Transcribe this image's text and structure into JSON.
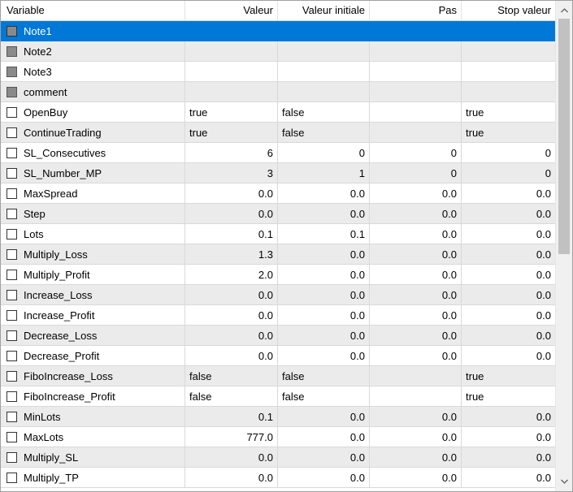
{
  "columns": [
    "Variable",
    "Valeur",
    "Valeur initiale",
    "Pas",
    "Stop valeur"
  ],
  "icons": {
    "scroll_up": "chevron-up-icon",
    "scroll_down": "chevron-down-icon"
  },
  "rows": [
    {
      "name": "Note1",
      "value": "",
      "initial": "",
      "step": "",
      "stop": "",
      "checkbox": "gray",
      "selected": true,
      "align": "r"
    },
    {
      "name": "Note2",
      "value": "",
      "initial": "",
      "step": "",
      "stop": "",
      "checkbox": "gray",
      "align": "r"
    },
    {
      "name": "Note3",
      "value": "",
      "initial": "",
      "step": "",
      "stop": "",
      "checkbox": "gray",
      "align": "r"
    },
    {
      "name": "comment",
      "value": "",
      "initial": "",
      "step": "",
      "stop": "",
      "checkbox": "gray",
      "align": "r"
    },
    {
      "name": "OpenBuy",
      "value": "true",
      "initial": "false",
      "step": "",
      "stop": "true",
      "checkbox": "white",
      "align": "l"
    },
    {
      "name": "ContinueTrading",
      "value": "true",
      "initial": "false",
      "step": "",
      "stop": "true",
      "checkbox": "white",
      "align": "l"
    },
    {
      "name": "SL_Consecutives",
      "value": "6",
      "initial": "0",
      "step": "0",
      "stop": "0",
      "checkbox": "white",
      "align": "r"
    },
    {
      "name": "SL_Number_MP",
      "value": "3",
      "initial": "1",
      "step": "0",
      "stop": "0",
      "checkbox": "white",
      "align": "r"
    },
    {
      "name": "MaxSpread",
      "value": "0.0",
      "initial": "0.0",
      "step": "0.0",
      "stop": "0.0",
      "checkbox": "white",
      "align": "r"
    },
    {
      "name": "Step",
      "value": "0.0",
      "initial": "0.0",
      "step": "0.0",
      "stop": "0.0",
      "checkbox": "white",
      "align": "r"
    },
    {
      "name": "Lots",
      "value": "0.1",
      "initial": "0.1",
      "step": "0.0",
      "stop": "0.0",
      "checkbox": "white",
      "align": "r"
    },
    {
      "name": "Multiply_Loss",
      "value": "1.3",
      "initial": "0.0",
      "step": "0.0",
      "stop": "0.0",
      "checkbox": "white",
      "align": "r"
    },
    {
      "name": "Multiply_Profit",
      "value": "2.0",
      "initial": "0.0",
      "step": "0.0",
      "stop": "0.0",
      "checkbox": "white",
      "align": "r"
    },
    {
      "name": "Increase_Loss",
      "value": "0.0",
      "initial": "0.0",
      "step": "0.0",
      "stop": "0.0",
      "checkbox": "white",
      "align": "r"
    },
    {
      "name": "Increase_Profit",
      "value": "0.0",
      "initial": "0.0",
      "step": "0.0",
      "stop": "0.0",
      "checkbox": "white",
      "align": "r"
    },
    {
      "name": "Decrease_Loss",
      "value": "0.0",
      "initial": "0.0",
      "step": "0.0",
      "stop": "0.0",
      "checkbox": "white",
      "align": "r"
    },
    {
      "name": "Decrease_Profit",
      "value": "0.0",
      "initial": "0.0",
      "step": "0.0",
      "stop": "0.0",
      "checkbox": "white",
      "align": "r"
    },
    {
      "name": "FiboIncrease_Loss",
      "value": "false",
      "initial": "false",
      "step": "",
      "stop": "true",
      "checkbox": "white",
      "align": "l"
    },
    {
      "name": "FiboIncrease_Profit",
      "value": "false",
      "initial": "false",
      "step": "",
      "stop": "true",
      "checkbox": "white",
      "align": "l"
    },
    {
      "name": "MinLots",
      "value": "0.1",
      "initial": "0.0",
      "step": "0.0",
      "stop": "0.0",
      "checkbox": "white",
      "align": "r"
    },
    {
      "name": "MaxLots",
      "value": "777.0",
      "initial": "0.0",
      "step": "0.0",
      "stop": "0.0",
      "checkbox": "white",
      "align": "r"
    },
    {
      "name": "Multiply_SL",
      "value": "0.0",
      "initial": "0.0",
      "step": "0.0",
      "stop": "0.0",
      "checkbox": "white",
      "align": "r"
    },
    {
      "name": "Multiply_TP",
      "value": "0.0",
      "initial": "0.0",
      "step": "0.0",
      "stop": "0.0",
      "checkbox": "white",
      "align": "r"
    }
  ]
}
